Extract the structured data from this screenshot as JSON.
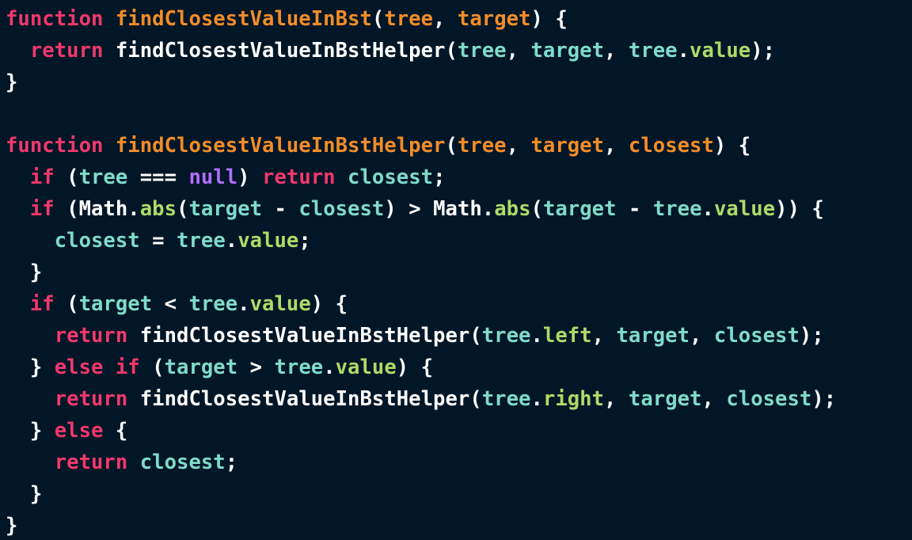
{
  "editor": {
    "language": "JavaScript",
    "theme_colors": {
      "background": "#011627",
      "keyword": "#f0386b",
      "function_name": "#f28c28",
      "identifier": "#7fdbca",
      "property": "#addb67",
      "null_literal": "#b06efa",
      "punctuation": "#ffffff"
    },
    "lines": [
      [
        {
          "t": "function",
          "k": "keyword"
        },
        {
          "t": " ",
          "k": "punctuation"
        },
        {
          "t": "findClosestValueInBst",
          "k": "function_name"
        },
        {
          "t": "(",
          "k": "punctuation"
        },
        {
          "t": "tree",
          "k": "function_name"
        },
        {
          "t": ", ",
          "k": "punctuation"
        },
        {
          "t": "target",
          "k": "function_name"
        },
        {
          "t": ") {",
          "k": "punctuation"
        }
      ],
      [
        {
          "t": "  ",
          "k": "punctuation"
        },
        {
          "t": "return",
          "k": "keyword"
        },
        {
          "t": " findClosestValueInBstHelper(",
          "k": "punctuation"
        },
        {
          "t": "tree",
          "k": "identifier"
        },
        {
          "t": ", ",
          "k": "punctuation"
        },
        {
          "t": "target",
          "k": "identifier"
        },
        {
          "t": ", ",
          "k": "punctuation"
        },
        {
          "t": "tree",
          "k": "identifier"
        },
        {
          "t": ".",
          "k": "punctuation"
        },
        {
          "t": "value",
          "k": "property"
        },
        {
          "t": ");",
          "k": "punctuation"
        }
      ],
      [
        {
          "t": "}",
          "k": "punctuation"
        }
      ],
      [],
      [
        {
          "t": "function",
          "k": "keyword"
        },
        {
          "t": " ",
          "k": "punctuation"
        },
        {
          "t": "findClosestValueInBstHelper",
          "k": "function_name"
        },
        {
          "t": "(",
          "k": "punctuation"
        },
        {
          "t": "tree",
          "k": "function_name"
        },
        {
          "t": ", ",
          "k": "punctuation"
        },
        {
          "t": "target",
          "k": "function_name"
        },
        {
          "t": ", ",
          "k": "punctuation"
        },
        {
          "t": "closest",
          "k": "function_name"
        },
        {
          "t": ") {",
          "k": "punctuation"
        }
      ],
      [
        {
          "t": "  ",
          "k": "punctuation"
        },
        {
          "t": "if",
          "k": "keyword"
        },
        {
          "t": " (",
          "k": "punctuation"
        },
        {
          "t": "tree",
          "k": "identifier"
        },
        {
          "t": " === ",
          "k": "punctuation"
        },
        {
          "t": "null",
          "k": "null_literal"
        },
        {
          "t": ") ",
          "k": "punctuation"
        },
        {
          "t": "return",
          "k": "keyword"
        },
        {
          "t": " ",
          "k": "punctuation"
        },
        {
          "t": "closest",
          "k": "identifier"
        },
        {
          "t": ";",
          "k": "punctuation"
        }
      ],
      [
        {
          "t": "  ",
          "k": "punctuation"
        },
        {
          "t": "if",
          "k": "keyword"
        },
        {
          "t": " (Math.",
          "k": "punctuation"
        },
        {
          "t": "abs",
          "k": "property"
        },
        {
          "t": "(",
          "k": "punctuation"
        },
        {
          "t": "target",
          "k": "identifier"
        },
        {
          "t": " - ",
          "k": "punctuation"
        },
        {
          "t": "closest",
          "k": "identifier"
        },
        {
          "t": ") > Math.",
          "k": "punctuation"
        },
        {
          "t": "abs",
          "k": "property"
        },
        {
          "t": "(",
          "k": "punctuation"
        },
        {
          "t": "target",
          "k": "identifier"
        },
        {
          "t": " - ",
          "k": "punctuation"
        },
        {
          "t": "tree",
          "k": "identifier"
        },
        {
          "t": ".",
          "k": "punctuation"
        },
        {
          "t": "value",
          "k": "property"
        },
        {
          "t": ")) {",
          "k": "punctuation"
        }
      ],
      [
        {
          "t": "    ",
          "k": "punctuation"
        },
        {
          "t": "closest",
          "k": "identifier"
        },
        {
          "t": " = ",
          "k": "punctuation"
        },
        {
          "t": "tree",
          "k": "identifier"
        },
        {
          "t": ".",
          "k": "punctuation"
        },
        {
          "t": "value",
          "k": "property"
        },
        {
          "t": ";",
          "k": "punctuation"
        }
      ],
      [
        {
          "t": "  }",
          "k": "punctuation"
        }
      ],
      [
        {
          "t": "  ",
          "k": "punctuation"
        },
        {
          "t": "if",
          "k": "keyword"
        },
        {
          "t": " (",
          "k": "punctuation"
        },
        {
          "t": "target",
          "k": "identifier"
        },
        {
          "t": " < ",
          "k": "punctuation"
        },
        {
          "t": "tree",
          "k": "identifier"
        },
        {
          "t": ".",
          "k": "punctuation"
        },
        {
          "t": "value",
          "k": "property"
        },
        {
          "t": ") {",
          "k": "punctuation"
        }
      ],
      [
        {
          "t": "    ",
          "k": "punctuation"
        },
        {
          "t": "return",
          "k": "keyword"
        },
        {
          "t": " findClosestValueInBstHelper(",
          "k": "punctuation"
        },
        {
          "t": "tree",
          "k": "identifier"
        },
        {
          "t": ".",
          "k": "punctuation"
        },
        {
          "t": "left",
          "k": "property"
        },
        {
          "t": ", ",
          "k": "punctuation"
        },
        {
          "t": "target",
          "k": "identifier"
        },
        {
          "t": ", ",
          "k": "punctuation"
        },
        {
          "t": "closest",
          "k": "identifier"
        },
        {
          "t": ");",
          "k": "punctuation"
        }
      ],
      [
        {
          "t": "  } ",
          "k": "punctuation"
        },
        {
          "t": "else",
          "k": "keyword"
        },
        {
          "t": " ",
          "k": "punctuation"
        },
        {
          "t": "if",
          "k": "keyword"
        },
        {
          "t": " (",
          "k": "punctuation"
        },
        {
          "t": "target",
          "k": "identifier"
        },
        {
          "t": " > ",
          "k": "punctuation"
        },
        {
          "t": "tree",
          "k": "identifier"
        },
        {
          "t": ".",
          "k": "punctuation"
        },
        {
          "t": "value",
          "k": "property"
        },
        {
          "t": ") {",
          "k": "punctuation"
        }
      ],
      [
        {
          "t": "    ",
          "k": "punctuation"
        },
        {
          "t": "return",
          "k": "keyword"
        },
        {
          "t": " findClosestValueInBstHelper(",
          "k": "punctuation"
        },
        {
          "t": "tree",
          "k": "identifier"
        },
        {
          "t": ".",
          "k": "punctuation"
        },
        {
          "t": "right",
          "k": "property"
        },
        {
          "t": ", ",
          "k": "punctuation"
        },
        {
          "t": "target",
          "k": "identifier"
        },
        {
          "t": ", ",
          "k": "punctuation"
        },
        {
          "t": "closest",
          "k": "identifier"
        },
        {
          "t": ");",
          "k": "punctuation"
        }
      ],
      [
        {
          "t": "  } ",
          "k": "punctuation"
        },
        {
          "t": "else",
          "k": "keyword"
        },
        {
          "t": " {",
          "k": "punctuation"
        }
      ],
      [
        {
          "t": "    ",
          "k": "punctuation"
        },
        {
          "t": "return",
          "k": "keyword"
        },
        {
          "t": " ",
          "k": "punctuation"
        },
        {
          "t": "closest",
          "k": "identifier"
        },
        {
          "t": ";",
          "k": "punctuation"
        }
      ],
      [
        {
          "t": "  }",
          "k": "punctuation"
        }
      ],
      [
        {
          "t": "}",
          "k": "punctuation"
        }
      ]
    ]
  }
}
